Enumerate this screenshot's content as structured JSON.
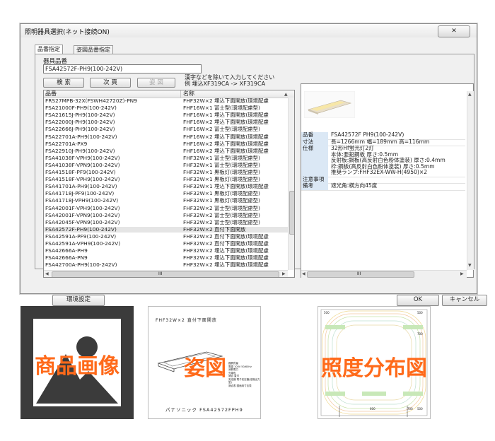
{
  "dialog": {
    "title": "照明器具選択(ネット接続ON)",
    "close_label": "✕",
    "tabs": [
      "品番指定",
      "姿図品番指定"
    ],
    "model_label": "器具品番",
    "model_value": "FSA42572F-PH9(100-242V)",
    "buttons": {
      "search": "検 索",
      "next": "次 頁",
      "prev": "姿 図"
    },
    "hint_line1": "漢字などを除いて入力してください",
    "hint_line2": "例 埋込XF319CA -> XF319CA",
    "list": {
      "headers": [
        "品番",
        "名称"
      ],
      "rows": [
        [
          "FRS27MPB-32X(FSWH42720Z)-PN9",
          "FHF32W×2 埋込下面開放(環境配慮"
        ],
        [
          "FSA21000F-PH9(100-242V)",
          "FHF16W×1 富士型(環境配慮型)"
        ],
        [
          "FSA21615J-PH9(100-242V)",
          "FHF16W×1 埋込下面開放(環境配慮"
        ],
        [
          "FSA22000J-PH9(100-242V)",
          "FHF16W×2 埋込下面開放(環境配慮"
        ],
        [
          "FSA22666J-PH9(100-242V)",
          "FHF16W×2 富士型(環境配慮型)"
        ],
        [
          "FSA22701A-PH9(100-242V)",
          "FHF16W×2 埋込下面開放(環境配慮"
        ],
        [
          "FSA22701A-PX9",
          "FHF16W×2 埋込下面開放(環境配慮"
        ],
        [
          "FSA22910J-PH9(100-242V)",
          "FHF16W×2 埋込下面開放(環境配慮"
        ],
        [
          "FSA41038F-VPH9(100-242V)",
          "FHF32W×1 富士型(環境配慮型)"
        ],
        [
          "FSA41038F-VPN9(100-242V)",
          "FHF32W×1 富士型(環境配慮型)"
        ],
        [
          "FSA41518F-PF9(100-242V)",
          "FHF32W×1 黒板灯(環境配慮型)"
        ],
        [
          "FSA41518F-VPH9(100-242V)",
          "FHF32W×1 黒板灯(環境配慮型)"
        ],
        [
          "FSA41701A-PH9(100-242V)",
          "FHF32W×1 埋込下面開放(環境配慮"
        ],
        [
          "FSA41718J-PF9(100-242V)",
          "FHF32W×1 黒板灯(環境配慮型)"
        ],
        [
          "FSA41718J-VPH9(100-242V)",
          "FHF32W×1 黒板灯(環境配慮型)"
        ],
        [
          "FSA42001F-VPH9(100-242V)",
          "FHF32W×2 富士型(環境配慮型)"
        ],
        [
          "FSA42001F-VPN9(100-242V)",
          "FHF32W×2 富士型(環境配慮型)"
        ],
        [
          "FSA42045F-VPN9(100-242V)",
          "FHF32W×2 富士型(環境配慮型)"
        ],
        [
          "FSA42572F-PH9(100-242V)",
          "FHF32W×2 直付下面開放"
        ],
        [
          "FSA42591A-PF9(100-242V)",
          "FHF32W×2 直付下面開放(環境配慮"
        ],
        [
          "FSA42591A-VPH9(100-242V)",
          "FHF32W×2 直付下面開放(環境配慮"
        ],
        [
          "FSA42666A-PH9",
          "FHF32W×2 埋込下面開放(環境配慮"
        ],
        [
          "FSA42666A-PN9",
          "FHF32W×2 埋込下面開放(環境配慮"
        ],
        [
          "FSA42700A-PH9(100-242V)",
          "FHF32W×2 埋込下面開放(環境配慮"
        ]
      ],
      "selected_index": 18
    },
    "detail": {
      "props": [
        {
          "k": "品番",
          "v": [
            "FSA42572F PH9(100-242V)"
          ]
        },
        {
          "k": "寸法",
          "v": [
            "長=1266mm 幅=189mm 高=116mm"
          ]
        },
        {
          "k": "仕様",
          "v": [
            "32形Hf蛍光灯2灯",
            "本体:亜鉛鋼板 厚さ:0.5mm",
            "反射板:鋼板(高反射白色粉体塗装) 厚さ:0.4mm",
            "枠:鋼板(高反射白色粉体塗装) 厚さ:0.5mm",
            "推奨ランプ:FHF32EX-WW-H(4950)×2"
          ]
        },
        {
          "k": "注意事項",
          "v": [
            ""
          ]
        },
        {
          "k": "備考",
          "v": [
            "遮光角:横方向45度"
          ]
        }
      ]
    },
    "env_button": "環境設定",
    "ok_button": "OK",
    "cancel_button": "キャンセル",
    "scroll_mark": "III"
  },
  "thumbnails": {
    "product_image": {
      "caption": "商品画像"
    },
    "figure": {
      "caption": "姿図",
      "header": "FHF32W×2 直付下面開放",
      "footer": "パナソニック FSA42572FPH9",
      "notes": [
        "器具質量",
        "電源 100V 50/60Hz",
        "消費電力",
        "光源色",
        "適合 直付",
        "安定器 電子安定器(定格出力型)",
        "適合表 図面用寸法表"
      ]
    },
    "illuminance": {
      "caption": "照度分布図",
      "labels": [
        "500",
        "500",
        "700",
        "600",
        "700",
        "500"
      ]
    }
  },
  "colors": {
    "caption_orange": "#ff6a1a",
    "dark_tile": "#3b3b3b",
    "prop_key_bg": "#dbe8f5"
  }
}
